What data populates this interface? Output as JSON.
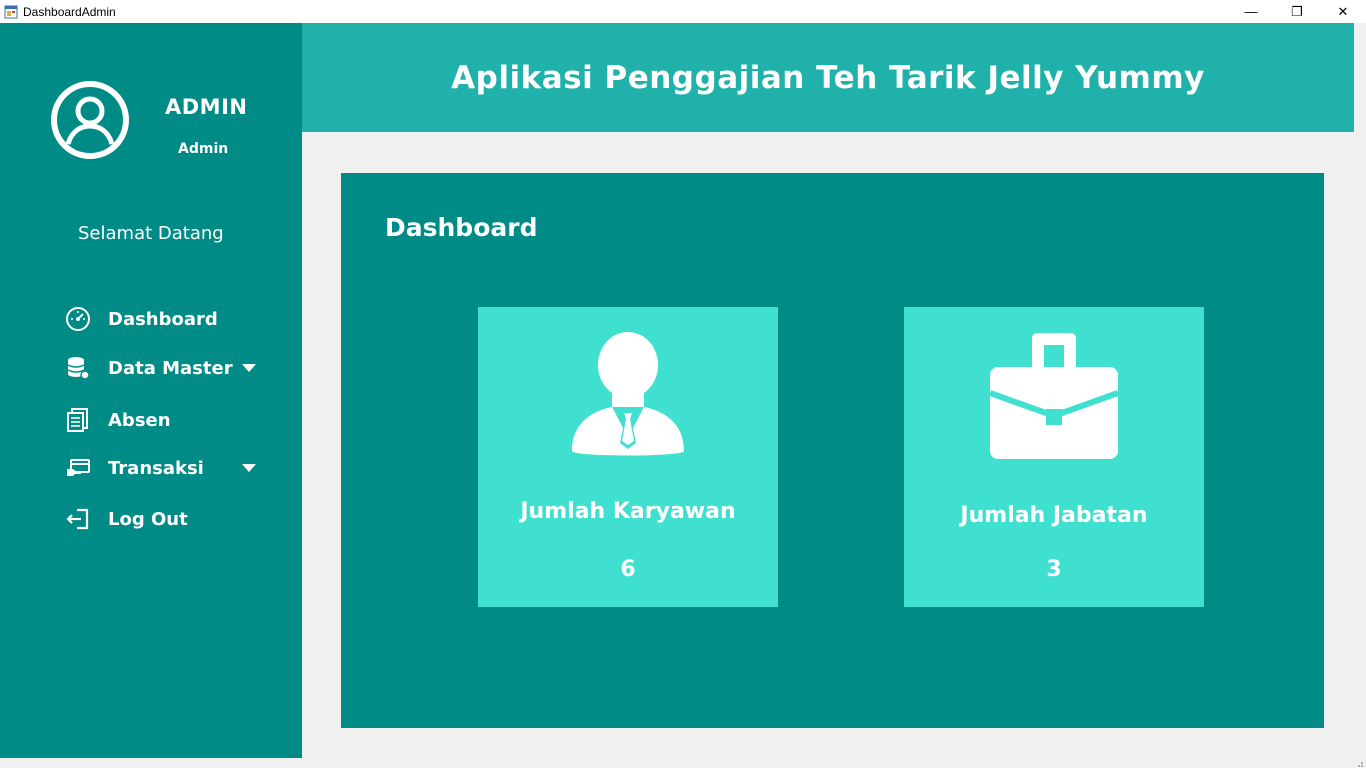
{
  "window": {
    "title": "DashboardAdmin",
    "controls": {
      "minimize": "—",
      "maximize": "❐",
      "close": "✕"
    }
  },
  "sidebar": {
    "user_name": "ADMIN",
    "user_role": "Admin",
    "welcome": "Selamat Datang",
    "items": [
      {
        "label": "Dashboard",
        "icon": "speedometer-icon"
      },
      {
        "label": "Data Master",
        "icon": "database-icon",
        "dropdown": true
      },
      {
        "label": "Absen",
        "icon": "documents-icon"
      },
      {
        "label": "Transaksi",
        "icon": "payment-card-icon",
        "dropdown": true
      },
      {
        "label": "Log Out",
        "icon": "logout-icon"
      }
    ]
  },
  "header": {
    "title": "Aplikasi Penggajian Teh Tarik Jelly Yummy"
  },
  "main": {
    "title": "Dashboard",
    "cards": [
      {
        "label": "Jumlah Karyawan",
        "value": "6",
        "icon": "employee-icon"
      },
      {
        "label": "Jumlah Jabatan",
        "value": "3",
        "icon": "briefcase-icon"
      }
    ]
  },
  "colors": {
    "sidebar": "#008b87",
    "header": "#20b2aa",
    "panel": "#008b87",
    "card": "#40e0d0",
    "background": "#f0f0f0"
  }
}
